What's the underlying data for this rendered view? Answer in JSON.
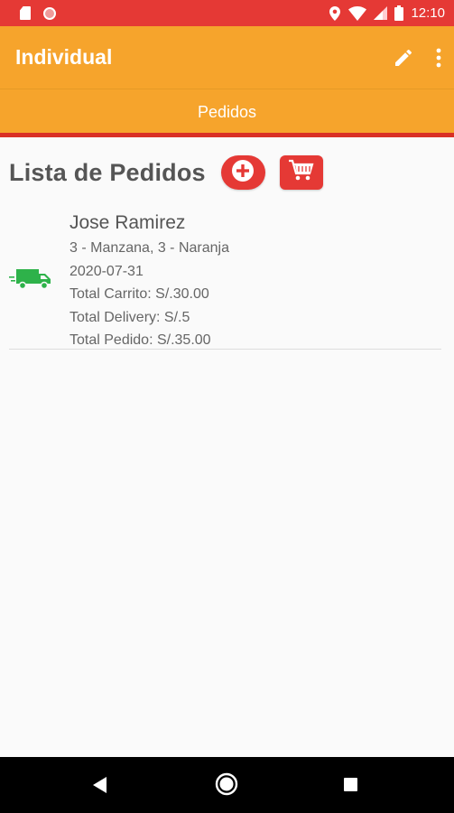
{
  "status_bar": {
    "time": "12:10",
    "icons": [
      "sd-card-icon",
      "record-icon",
      "location-icon",
      "wifi-icon",
      "signal-icon",
      "battery-icon"
    ]
  },
  "app_bar": {
    "title": "Individual",
    "icons": [
      "edit-icon",
      "more-vert-icon"
    ]
  },
  "tabs": [
    {
      "label": "Pedidos",
      "selected": true
    }
  ],
  "list": {
    "title": "Lista de Pedidos",
    "add_icon": "add-circle-icon",
    "cart_icon": "shopping-cart-icon",
    "orders": [
      {
        "icon": "truck-icon",
        "name": "Jose Ramirez",
        "items": "3 - Manzana, 3 - Naranja",
        "date": "2020-07-31",
        "total_cart": "Total Carrito: S/.30.00",
        "total_delivery": "Total Delivery: S/.5",
        "total_order": "Total Pedido: S/.35.00"
      }
    ]
  },
  "colors": {
    "status_bar": "#e53935",
    "app_bar": "#f6a42c",
    "tab_indicator": "#d93025",
    "accent_red": "#e53935",
    "truck_green": "#2eb24a"
  }
}
